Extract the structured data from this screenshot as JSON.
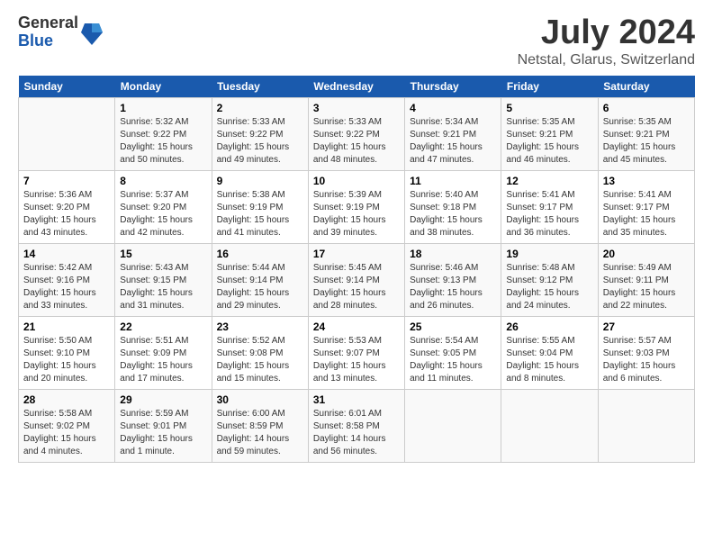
{
  "logo": {
    "general": "General",
    "blue": "Blue"
  },
  "title": "July 2024",
  "subtitle": "Netstal, Glarus, Switzerland",
  "weekdays": [
    "Sunday",
    "Monday",
    "Tuesday",
    "Wednesday",
    "Thursday",
    "Friday",
    "Saturday"
  ],
  "weeks": [
    [
      {
        "day": "",
        "info": ""
      },
      {
        "day": "1",
        "info": "Sunrise: 5:32 AM\nSunset: 9:22 PM\nDaylight: 15 hours\nand 50 minutes."
      },
      {
        "day": "2",
        "info": "Sunrise: 5:33 AM\nSunset: 9:22 PM\nDaylight: 15 hours\nand 49 minutes."
      },
      {
        "day": "3",
        "info": "Sunrise: 5:33 AM\nSunset: 9:22 PM\nDaylight: 15 hours\nand 48 minutes."
      },
      {
        "day": "4",
        "info": "Sunrise: 5:34 AM\nSunset: 9:21 PM\nDaylight: 15 hours\nand 47 minutes."
      },
      {
        "day": "5",
        "info": "Sunrise: 5:35 AM\nSunset: 9:21 PM\nDaylight: 15 hours\nand 46 minutes."
      },
      {
        "day": "6",
        "info": "Sunrise: 5:35 AM\nSunset: 9:21 PM\nDaylight: 15 hours\nand 45 minutes."
      }
    ],
    [
      {
        "day": "7",
        "info": "Sunrise: 5:36 AM\nSunset: 9:20 PM\nDaylight: 15 hours\nand 43 minutes."
      },
      {
        "day": "8",
        "info": "Sunrise: 5:37 AM\nSunset: 9:20 PM\nDaylight: 15 hours\nand 42 minutes."
      },
      {
        "day": "9",
        "info": "Sunrise: 5:38 AM\nSunset: 9:19 PM\nDaylight: 15 hours\nand 41 minutes."
      },
      {
        "day": "10",
        "info": "Sunrise: 5:39 AM\nSunset: 9:19 PM\nDaylight: 15 hours\nand 39 minutes."
      },
      {
        "day": "11",
        "info": "Sunrise: 5:40 AM\nSunset: 9:18 PM\nDaylight: 15 hours\nand 38 minutes."
      },
      {
        "day": "12",
        "info": "Sunrise: 5:41 AM\nSunset: 9:17 PM\nDaylight: 15 hours\nand 36 minutes."
      },
      {
        "day": "13",
        "info": "Sunrise: 5:41 AM\nSunset: 9:17 PM\nDaylight: 15 hours\nand 35 minutes."
      }
    ],
    [
      {
        "day": "14",
        "info": "Sunrise: 5:42 AM\nSunset: 9:16 PM\nDaylight: 15 hours\nand 33 minutes."
      },
      {
        "day": "15",
        "info": "Sunrise: 5:43 AM\nSunset: 9:15 PM\nDaylight: 15 hours\nand 31 minutes."
      },
      {
        "day": "16",
        "info": "Sunrise: 5:44 AM\nSunset: 9:14 PM\nDaylight: 15 hours\nand 29 minutes."
      },
      {
        "day": "17",
        "info": "Sunrise: 5:45 AM\nSunset: 9:14 PM\nDaylight: 15 hours\nand 28 minutes."
      },
      {
        "day": "18",
        "info": "Sunrise: 5:46 AM\nSunset: 9:13 PM\nDaylight: 15 hours\nand 26 minutes."
      },
      {
        "day": "19",
        "info": "Sunrise: 5:48 AM\nSunset: 9:12 PM\nDaylight: 15 hours\nand 24 minutes."
      },
      {
        "day": "20",
        "info": "Sunrise: 5:49 AM\nSunset: 9:11 PM\nDaylight: 15 hours\nand 22 minutes."
      }
    ],
    [
      {
        "day": "21",
        "info": "Sunrise: 5:50 AM\nSunset: 9:10 PM\nDaylight: 15 hours\nand 20 minutes."
      },
      {
        "day": "22",
        "info": "Sunrise: 5:51 AM\nSunset: 9:09 PM\nDaylight: 15 hours\nand 17 minutes."
      },
      {
        "day": "23",
        "info": "Sunrise: 5:52 AM\nSunset: 9:08 PM\nDaylight: 15 hours\nand 15 minutes."
      },
      {
        "day": "24",
        "info": "Sunrise: 5:53 AM\nSunset: 9:07 PM\nDaylight: 15 hours\nand 13 minutes."
      },
      {
        "day": "25",
        "info": "Sunrise: 5:54 AM\nSunset: 9:05 PM\nDaylight: 15 hours\nand 11 minutes."
      },
      {
        "day": "26",
        "info": "Sunrise: 5:55 AM\nSunset: 9:04 PM\nDaylight: 15 hours\nand 8 minutes."
      },
      {
        "day": "27",
        "info": "Sunrise: 5:57 AM\nSunset: 9:03 PM\nDaylight: 15 hours\nand 6 minutes."
      }
    ],
    [
      {
        "day": "28",
        "info": "Sunrise: 5:58 AM\nSunset: 9:02 PM\nDaylight: 15 hours\nand 4 minutes."
      },
      {
        "day": "29",
        "info": "Sunrise: 5:59 AM\nSunset: 9:01 PM\nDaylight: 15 hours\nand 1 minute."
      },
      {
        "day": "30",
        "info": "Sunrise: 6:00 AM\nSunset: 8:59 PM\nDaylight: 14 hours\nand 59 minutes."
      },
      {
        "day": "31",
        "info": "Sunrise: 6:01 AM\nSunset: 8:58 PM\nDaylight: 14 hours\nand 56 minutes."
      },
      {
        "day": "",
        "info": ""
      },
      {
        "day": "",
        "info": ""
      },
      {
        "day": "",
        "info": ""
      }
    ]
  ]
}
